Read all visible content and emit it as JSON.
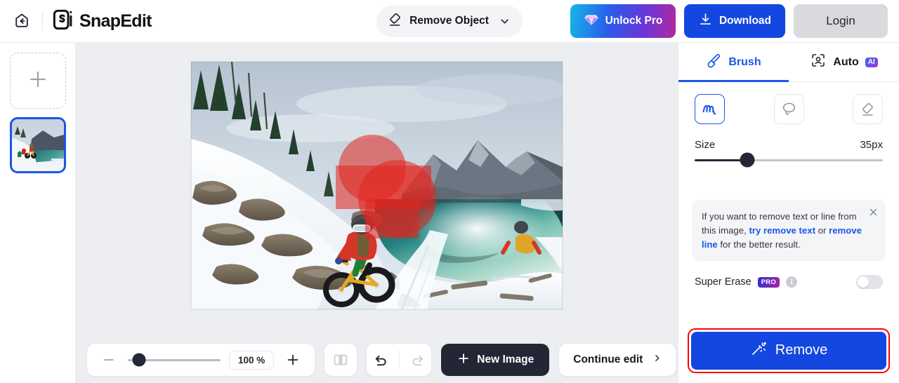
{
  "header": {
    "back_icon": "home-back-icon",
    "brand_logo": "snapedit-logo-icon",
    "brand_name": "SnapEdit",
    "mode": {
      "icon": "eraser-icon",
      "label": "Remove Object",
      "chevron": "chevron-down-icon"
    },
    "unlock_pro": {
      "label": "Unlock Pro",
      "icon": "diamond-icon"
    },
    "download": {
      "label": "Download",
      "icon": "download-icon"
    },
    "login": {
      "label": "Login"
    }
  },
  "rail": {
    "add_label": "+",
    "add_icon": "plus-icon",
    "items": [
      {
        "name": "winter-bike-lake-thumbnail",
        "selected": true
      }
    ]
  },
  "canvas": {
    "image_name": "snow-mountain-lake-fatbike-photo",
    "mask_color": "#e2241e",
    "bottom_toolbar": {
      "zoom_out_icon": "minus-icon",
      "zoom_in_icon": "plus-icon",
      "zoom_value": "100 %",
      "compare_icon": "compare-split-icon",
      "undo_icon": "undo-icon",
      "redo_icon": "redo-icon",
      "new_image": {
        "label": "New Image",
        "icon": "plus-icon"
      },
      "continue_edit": {
        "label": "Continue edit",
        "chevron": "chevron-right-icon"
      }
    }
  },
  "panel": {
    "tabs": [
      {
        "label": "Brush",
        "icon": "brush-icon",
        "active": true
      },
      {
        "label": "Auto",
        "icon": "face-scan-icon",
        "badge": "AI",
        "active": false
      }
    ],
    "tools": [
      {
        "name": "brush-tool",
        "icon": "scribble-icon",
        "active": true
      },
      {
        "name": "lasso-tool",
        "icon": "lasso-icon",
        "active": false
      },
      {
        "name": "eraser-tool",
        "icon": "eraser-icon",
        "active": false
      }
    ],
    "size": {
      "label": "Size",
      "value": "35px"
    },
    "hint": {
      "close_icon": "close-icon",
      "part1": "If you want to remove text or line from this image, ",
      "link1": "try remove text",
      "mid": " or ",
      "link2": "remove line",
      "part2": " for the better result."
    },
    "super_erase": {
      "label": "Super Erase",
      "badge": "PRO",
      "info_icon": "info-icon",
      "enabled": false
    },
    "remove_button": {
      "label": "Remove",
      "icon": "magic-wand-icon",
      "accent": "#1347e0",
      "highlight": "#ff0000"
    }
  }
}
